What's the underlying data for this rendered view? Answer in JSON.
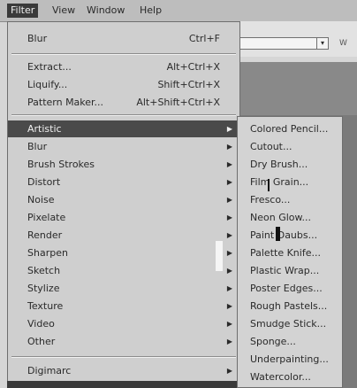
{
  "menubar": {
    "items": [
      "Filter",
      "View",
      "Window",
      "Help"
    ]
  },
  "filter_menu": {
    "last_filter": {
      "label": "Blur",
      "shortcut": "Ctrl+F"
    },
    "group2": [
      {
        "label": "Extract...",
        "shortcut": "Alt+Ctrl+X"
      },
      {
        "label": "Liquify...",
        "shortcut": "Shift+Ctrl+X"
      },
      {
        "label": "Pattern Maker...",
        "shortcut": "Alt+Shift+Ctrl+X"
      }
    ],
    "categories": [
      "Artistic",
      "Blur",
      "Brush Strokes",
      "Distort",
      "Noise",
      "Pixelate",
      "Render",
      "Sharpen",
      "Sketch",
      "Stylize",
      "Texture",
      "Video",
      "Other"
    ],
    "digimarc": "Digimarc"
  },
  "artistic_submenu": [
    "Colored Pencil...",
    "Cutout...",
    "Dry Brush...",
    "Film Grain...",
    "Fresco...",
    "Neon Glow...",
    "Paint Daubs...",
    "Palette Knife...",
    "Plastic Wrap...",
    "Poster Edges...",
    "Rough Pastels...",
    "Smudge Stick...",
    "Sponge...",
    "Underpainting...",
    "Watercolor..."
  ],
  "background": {
    "dropdown_arrow": "▾",
    "side_label": "W"
  },
  "icons": {
    "submenu_arrow": "▶"
  }
}
